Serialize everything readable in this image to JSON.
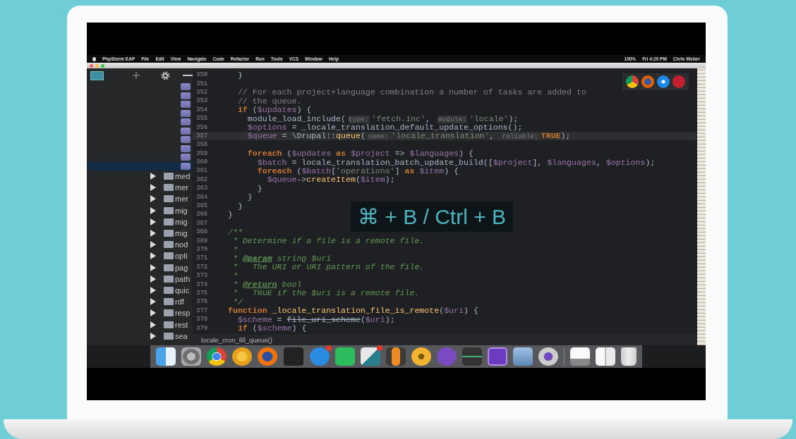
{
  "menu_bar": {
    "app": "PhpStorm EAP",
    "items": [
      "File",
      "Edit",
      "View",
      "Navigate",
      "Code",
      "Refactor",
      "Run",
      "Tools",
      "VCS",
      "Window",
      "Help"
    ],
    "status": [
      "100%",
      "Fri 4:20 PM",
      "Chris Weber"
    ]
  },
  "project_tree": {
    "files": [
      {
        "selected": false
      },
      {
        "selected": false
      },
      {
        "selected": false
      },
      {
        "selected": false
      },
      {
        "selected": false
      },
      {
        "selected": false
      },
      {
        "selected": false
      },
      {
        "selected": false
      },
      {
        "selected": false
      },
      {
        "selected": true
      }
    ],
    "folders": [
      {
        "label": "med",
        "expanded": false
      },
      {
        "label": "mer",
        "expanded": false
      },
      {
        "label": "mer",
        "expanded": false
      },
      {
        "label": "mig",
        "expanded": false
      },
      {
        "label": "mig",
        "expanded": false
      },
      {
        "label": "mig",
        "expanded": false
      },
      {
        "label": "nod",
        "expanded": false
      },
      {
        "label": "opti",
        "expanded": false
      },
      {
        "label": "pag",
        "expanded": false
      },
      {
        "label": "path",
        "expanded": false
      },
      {
        "label": "quic",
        "expanded": false
      },
      {
        "label": "rdf",
        "expanded": false
      },
      {
        "label": "resp",
        "expanded": false
      },
      {
        "label": "rest",
        "expanded": false
      },
      {
        "label": "sea",
        "expanded": false
      }
    ]
  },
  "editor": {
    "lines": [
      {
        "number": "350",
        "current": false,
        "segments": [
          {
            "kind": "plain",
            "text": "  }"
          }
        ]
      },
      {
        "number": "351",
        "current": false
      },
      {
        "number": "352",
        "current": false,
        "segments": [
          {
            "kind": "comment",
            "text": "  // For each project+language combination a number of tasks are added to"
          }
        ]
      },
      {
        "number": "353",
        "current": false,
        "segments": [
          {
            "kind": "comment",
            "text": "  // the queue."
          }
        ]
      },
      {
        "number": "354",
        "current": false,
        "segments": [
          {
            "kind": "keyword",
            "text": "  if"
          },
          {
            "kind": "plain",
            "text": " ("
          },
          {
            "kind": "variable",
            "text": "$updates"
          },
          {
            "kind": "plain",
            "text": ") {"
          }
        ]
      },
      {
        "number": "355",
        "current": false,
        "segments": [
          {
            "kind": "plain",
            "text": "    module_load_include("
          },
          {
            "kind": "hint",
            "text": "type:"
          },
          {
            "kind": "string",
            "text": "'fetch.inc'"
          },
          {
            "kind": "plain",
            "text": ", "
          },
          {
            "kind": "hint",
            "text": "module:"
          },
          {
            "kind": "string",
            "text": "'locale'"
          },
          {
            "kind": "plain",
            "text": ");"
          }
        ]
      },
      {
        "number": "356",
        "current": false,
        "segments": [
          {
            "kind": "variable",
            "text": "    $options"
          },
          {
            "kind": "plain",
            "text": " = _locale_translation_default_update_options();"
          }
        ]
      },
      {
        "number": "357",
        "current": true,
        "segments": [
          {
            "kind": "variable",
            "text": "    $queue"
          },
          {
            "kind": "plain",
            "text": " = \\Drupal::"
          },
          {
            "kind": "function",
            "text": "queue"
          },
          {
            "kind": "plain",
            "text": "("
          },
          {
            "kind": "hint",
            "text": "name:"
          },
          {
            "kind": "string",
            "text": "'locale_translation'"
          },
          {
            "kind": "plain",
            "text": ", "
          },
          {
            "kind": "hint",
            "text": "reliable:"
          },
          {
            "kind": "keyword",
            "text": "TRUE"
          },
          {
            "kind": "plain",
            "text": ");"
          }
        ]
      },
      {
        "number": "358",
        "current": false
      },
      {
        "number": "359",
        "current": false,
        "segments": [
          {
            "kind": "keyword",
            "text": "    foreach"
          },
          {
            "kind": "plain",
            "text": " ("
          },
          {
            "kind": "variable",
            "text": "$updates"
          },
          {
            "kind": "keyword",
            "text": " as "
          },
          {
            "kind": "variable",
            "text": "$project"
          },
          {
            "kind": "plain",
            "text": " => "
          },
          {
            "kind": "variable",
            "text": "$languages"
          },
          {
            "kind": "plain",
            "text": ") {"
          }
        ]
      },
      {
        "number": "360",
        "current": false,
        "segments": [
          {
            "kind": "variable",
            "text": "      $batch"
          },
          {
            "kind": "plain",
            "text": " = locale_translation_batch_update_build(["
          },
          {
            "kind": "variable",
            "text": "$project"
          },
          {
            "kind": "plain",
            "text": "], "
          },
          {
            "kind": "variable",
            "text": "$languages"
          },
          {
            "kind": "plain",
            "text": ", "
          },
          {
            "kind": "variable",
            "text": "$options"
          },
          {
            "kind": "plain",
            "text": ");"
          }
        ]
      },
      {
        "number": "361",
        "current": false,
        "segments": [
          {
            "kind": "keyword",
            "text": "      foreach"
          },
          {
            "kind": "plain",
            "text": " ("
          },
          {
            "kind": "variable",
            "text": "$batch"
          },
          {
            "kind": "plain",
            "text": "["
          },
          {
            "kind": "string",
            "text": "'operations'"
          },
          {
            "kind": "plain",
            "text": "]"
          },
          {
            "kind": "keyword",
            "text": " as "
          },
          {
            "kind": "variable",
            "text": "$item"
          },
          {
            "kind": "plain",
            "text": ") {"
          }
        ]
      },
      {
        "number": "362",
        "current": false,
        "segments": [
          {
            "kind": "variable",
            "text": "        $queue"
          },
          {
            "kind": "plain",
            "text": "->"
          },
          {
            "kind": "function",
            "text": "createItem"
          },
          {
            "kind": "plain",
            "text": "("
          },
          {
            "kind": "variable",
            "text": "$item"
          },
          {
            "kind": "plain",
            "text": ");"
          }
        ]
      },
      {
        "number": "363",
        "current": false,
        "segments": [
          {
            "kind": "plain",
            "text": "      }"
          }
        ]
      },
      {
        "number": "364",
        "current": false,
        "segments": [
          {
            "kind": "plain",
            "text": "    }"
          }
        ]
      },
      {
        "number": "365",
        "current": false,
        "segments": [
          {
            "kind": "plain",
            "text": "  }"
          }
        ]
      },
      {
        "number": "366",
        "current": false,
        "segments": [
          {
            "kind": "plain",
            "text": "}"
          }
        ]
      },
      {
        "number": "367",
        "current": false
      },
      {
        "number": "368",
        "current": false,
        "segments": [
          {
            "kind": "doc",
            "text": "/**"
          }
        ]
      },
      {
        "number": "369",
        "current": false,
        "segments": [
          {
            "kind": "doc",
            "text": " * Determine if a file is a remote file."
          }
        ]
      },
      {
        "number": "370",
        "current": false,
        "segments": [
          {
            "kind": "doc",
            "text": " *"
          }
        ]
      },
      {
        "number": "371",
        "current": false,
        "segments": [
          {
            "kind": "doc",
            "text": " * "
          },
          {
            "kind": "doctag",
            "text": "@param"
          },
          {
            "kind": "doc",
            "text": " string $uri"
          }
        ]
      },
      {
        "number": "372",
        "current": false,
        "segments": [
          {
            "kind": "doc",
            "text": " *   The URI or URI pattern of the file."
          }
        ]
      },
      {
        "number": "373",
        "current": false,
        "segments": [
          {
            "kind": "doc",
            "text": " *"
          }
        ]
      },
      {
        "number": "374",
        "current": false,
        "segments": [
          {
            "kind": "doc",
            "text": " * "
          },
          {
            "kind": "doctag",
            "text": "@return"
          },
          {
            "kind": "doc",
            "text": " bool"
          }
        ]
      },
      {
        "number": "375",
        "current": false,
        "segments": [
          {
            "kind": "doc",
            "text": " *   TRUE if the $uri is a remote file."
          }
        ]
      },
      {
        "number": "376",
        "current": false,
        "segments": [
          {
            "kind": "doc",
            "text": " */"
          }
        ]
      },
      {
        "number": "377",
        "current": false,
        "segments": [
          {
            "kind": "keyword",
            "text": "function"
          },
          {
            "kind": "function",
            "text": " _locale_translation_file_is_remote"
          },
          {
            "kind": "plain",
            "text": "("
          },
          {
            "kind": "variable",
            "text": "$uri"
          },
          {
            "kind": "plain",
            "text": ") {"
          }
        ]
      },
      {
        "number": "378",
        "current": false,
        "segments": [
          {
            "kind": "variable",
            "text": "  $scheme"
          },
          {
            "kind": "plain",
            "text": " = "
          },
          {
            "kind": "deprecated",
            "text": "file_uri_scheme"
          },
          {
            "kind": "plain",
            "text": "("
          },
          {
            "kind": "variable",
            "text": "$uri"
          },
          {
            "kind": "plain",
            "text": ");"
          }
        ]
      },
      {
        "number": "379",
        "current": false,
        "segments": [
          {
            "kind": "keyword",
            "text": "  if"
          },
          {
            "kind": "plain",
            "text": " ("
          },
          {
            "kind": "variable",
            "text": "$scheme"
          },
          {
            "kind": "plain",
            "text": ") {"
          }
        ]
      }
    ],
    "breadcrumb": "locale_cron_fill_queue()"
  },
  "shortcut_overlay": "⌘ + B / Ctrl + B",
  "dock": [
    {
      "badge": false
    },
    {
      "badge": false
    },
    {
      "badge": false
    },
    {
      "badge": false
    },
    {
      "badge": false
    },
    {
      "badge": false
    },
    {
      "badge": true
    },
    {
      "badge": false
    },
    {
      "badge": true
    },
    {
      "badge": false
    },
    {
      "badge": false
    },
    {
      "badge": false
    },
    {
      "badge": false
    },
    {
      "badge": false
    },
    {
      "badge": false
    },
    {
      "badge": false
    },
    {
      "badge": false
    },
    {
      "badge": false
    },
    {
      "badge": false
    }
  ]
}
